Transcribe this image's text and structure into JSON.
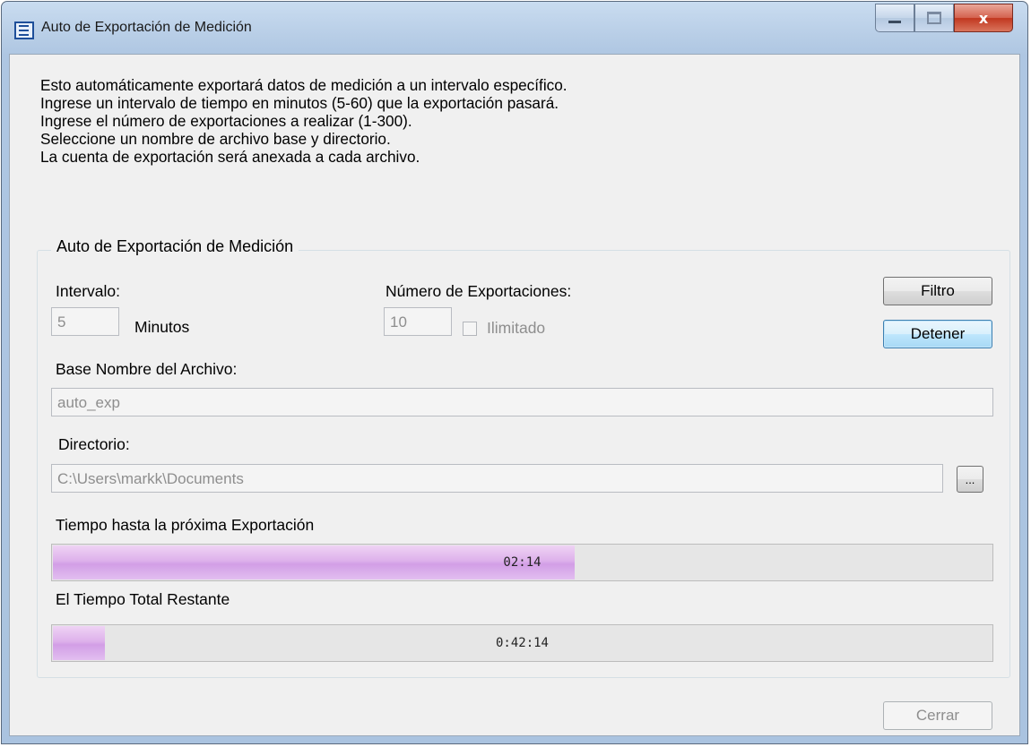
{
  "window": {
    "title": "Auto de Exportación de Medición",
    "close_glyph": "x"
  },
  "intro": [
    "Esto automáticamente exportará datos de medición a un intervalo específico.",
    "Ingrese un intervalo de tiempo en minutos (5-60) que la exportación pasará.",
    "Ingrese el número de exportaciones a realizar (1-300).",
    "Seleccione un nombre de archivo base y directorio.",
    "La cuenta de exportación será anexada a cada archivo."
  ],
  "group": {
    "title": "Auto de Exportación de Medición",
    "interval_label": "Intervalo:",
    "interval_value": "5",
    "minutes_label": "Minutos",
    "exports_label": "Número de Exportaciones:",
    "exports_value": "10",
    "unlimited_label": "Ilimitado",
    "unlimited_checked": false,
    "filter_button": "Filtro",
    "stop_button": "Detener",
    "basename_label": "Base Nombre del Archivo:",
    "basename_value": "auto_exp",
    "directory_label": "Directorio:",
    "directory_value": "C:\\Users\\markk\\Documents",
    "browse_button": "...",
    "next_label": "Tiempo hasta la próxima Exportación",
    "next_text": "02:14",
    "next_progress_percent": 55.5,
    "total_label": "El Tiempo Total Restante",
    "total_text": "0:42:14",
    "total_progress_percent": 5.5
  },
  "footer": {
    "close_button": "Cerrar"
  },
  "colors": {
    "progress_fill": "#d9a8ea",
    "title_bar": "#b7cde6"
  }
}
